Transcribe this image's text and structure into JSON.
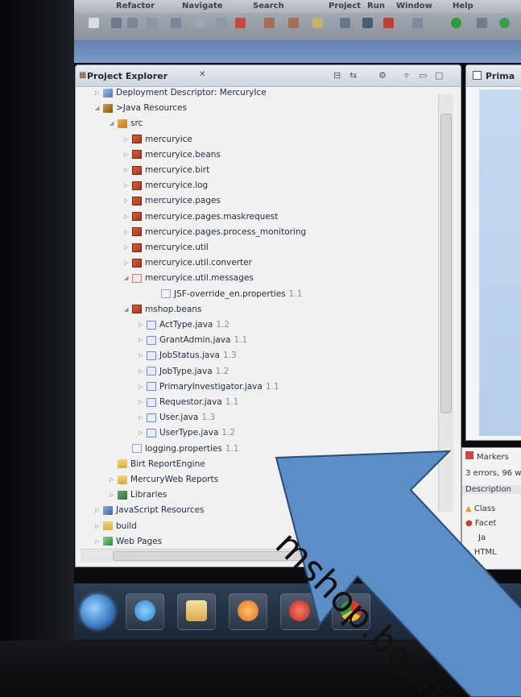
{
  "menubar": {
    "items": [
      "Refactor",
      "Navigate",
      "Search",
      "Project",
      "Run",
      "Window",
      "Help"
    ]
  },
  "explorer": {
    "title": "Project Explorer",
    "close_glyph": "✕",
    "tree": [
      {
        "label": "Deployment Descriptor: MercuryIce",
        "indent": 1,
        "twisty": "collapsed",
        "icon": "deployment-descriptor-icon",
        "version": ""
      },
      {
        "label": ">Java Resources",
        "indent": 1,
        "twisty": "expanded",
        "icon": "java-resources-icon",
        "version": ""
      },
      {
        "label": "src",
        "indent": 2,
        "twisty": "expanded",
        "icon": "source-folder-icon",
        "version": ""
      },
      {
        "label": "mercuryice",
        "indent": 3,
        "twisty": "collapsed",
        "icon": "package-icon",
        "version": ""
      },
      {
        "label": "mercuryice.beans",
        "indent": 3,
        "twisty": "collapsed",
        "icon": "package-icon",
        "version": ""
      },
      {
        "label": "mercuryice.birt",
        "indent": 3,
        "twisty": "collapsed",
        "icon": "package-icon",
        "version": ""
      },
      {
        "label": "mercuryice.log",
        "indent": 3,
        "twisty": "collapsed",
        "icon": "package-icon",
        "version": ""
      },
      {
        "label": "mercuryice.pages",
        "indent": 3,
        "twisty": "collapsed",
        "icon": "package-icon",
        "version": ""
      },
      {
        "label": "mercuryice.pages.maskrequest",
        "indent": 3,
        "twisty": "collapsed",
        "icon": "package-icon",
        "version": ""
      },
      {
        "label": "mercuryice.pages.process_monitoring",
        "indent": 3,
        "twisty": "collapsed",
        "icon": "package-icon",
        "version": ""
      },
      {
        "label": "mercuryice.util",
        "indent": 3,
        "twisty": "collapsed",
        "icon": "package-icon",
        "version": ""
      },
      {
        "label": "mercuryice.util.converter",
        "indent": 3,
        "twisty": "collapsed",
        "icon": "package-icon",
        "version": ""
      },
      {
        "label": "mercuryice.util.messages",
        "indent": 3,
        "twisty": "expanded",
        "icon": "empty-package-icon",
        "version": ""
      },
      {
        "label": "JSF-override_en.properties",
        "indent": 5,
        "twisty": "none",
        "icon": "properties-file-icon",
        "version": "1.1"
      },
      {
        "label": "mshop.beans",
        "indent": 3,
        "twisty": "expanded",
        "icon": "package-icon",
        "version": ""
      },
      {
        "label": "ActType.java",
        "indent": 4,
        "twisty": "collapsed",
        "icon": "java-file-icon",
        "version": "1.2"
      },
      {
        "label": "GrantAdmin.java",
        "indent": 4,
        "twisty": "collapsed",
        "icon": "java-file-icon",
        "version": "1.1"
      },
      {
        "label": "JobStatus.java",
        "indent": 4,
        "twisty": "collapsed",
        "icon": "java-file-icon",
        "version": "1.3"
      },
      {
        "label": "JobType.java",
        "indent": 4,
        "twisty": "collapsed",
        "icon": "java-file-icon",
        "version": "1.2"
      },
      {
        "label": "PrimaryInvestigator.java",
        "indent": 4,
        "twisty": "collapsed",
        "icon": "java-file-icon",
        "version": "1.1"
      },
      {
        "label": "Requestor.java",
        "indent": 4,
        "twisty": "collapsed",
        "icon": "java-file-icon",
        "version": "1.1"
      },
      {
        "label": "User.java",
        "indent": 4,
        "twisty": "collapsed",
        "icon": "java-file-icon",
        "version": "1.3"
      },
      {
        "label": "UserType.java",
        "indent": 4,
        "twisty": "collapsed",
        "icon": "java-file-icon",
        "version": "1.2"
      },
      {
        "label": "logging.properties",
        "indent": 3,
        "twisty": "none",
        "icon": "properties-file-icon",
        "version": "1.1"
      },
      {
        "label": "Birt ReportEngine",
        "indent": 2,
        "twisty": "none",
        "icon": "folder-icon",
        "version": ""
      },
      {
        "label": "MercuryWeb Reports",
        "indent": 2,
        "twisty": "collapsed",
        "icon": "folder-icon",
        "version": ""
      },
      {
        "label": "Libraries",
        "indent": 2,
        "twisty": "collapsed",
        "icon": "libraries-icon",
        "version": ""
      },
      {
        "label": "JavaScript Resources",
        "indent": 1,
        "twisty": "collapsed",
        "icon": "javascript-resources-icon",
        "version": ""
      },
      {
        "label": "build",
        "indent": 1,
        "twisty": "collapsed",
        "icon": "folder-icon",
        "version": ""
      },
      {
        "label": "Web Pages",
        "indent": 1,
        "twisty": "collapsed",
        "icon": "web-pages-icon",
        "version": ""
      }
    ]
  },
  "editor": {
    "tab_title": "Prima"
  },
  "markers": {
    "tab_title": "Markers",
    "summary": "3 errors, 96 w",
    "column_header": "Description",
    "rows": [
      "Class",
      "Facet",
      "Ja",
      "HTML"
    ]
  },
  "annotation": {
    "text": "mshop.beans",
    "arrow_color": "#5b8dc6",
    "arrow_outline": "#2a4d78"
  },
  "colors": {
    "tree_text": "#1d2c3f",
    "version_text": "#8a8f96",
    "panel_bg": "#f1f1f1"
  }
}
